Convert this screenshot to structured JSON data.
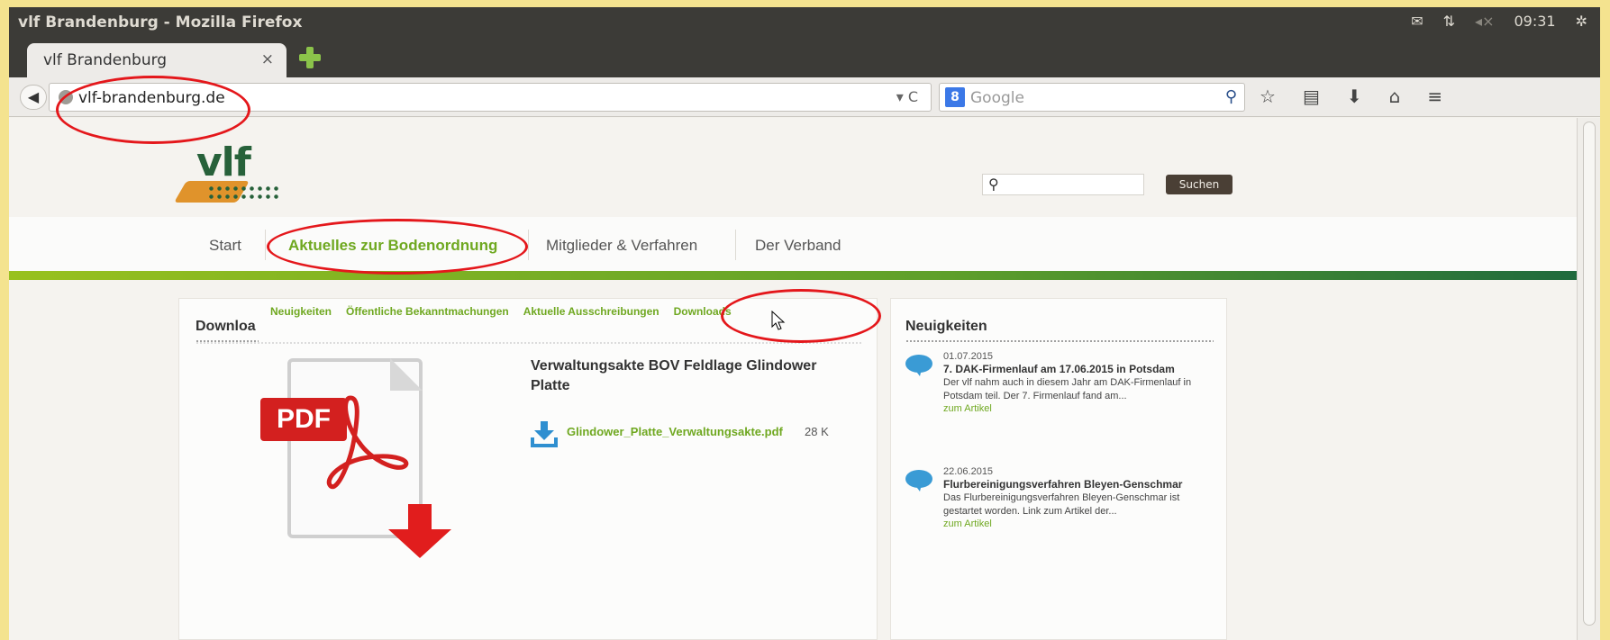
{
  "window": {
    "title": "vlf Brandenburg - Mozilla Firefox"
  },
  "tray": {
    "clock": "09:31"
  },
  "tab": {
    "label": "vlf Brandenburg",
    "close": "×"
  },
  "navbar": {
    "url": "vlf-brandenburg.de",
    "search_engine": "Google",
    "reload": "▾ C"
  },
  "site": {
    "logo_text": "vlf",
    "search_button": "Suchen",
    "main_nav": [
      "Start",
      "Aktuelles zur Bodenordnung",
      "Mitglieder & Verfahren",
      "Der Verband"
    ],
    "active_nav": "Aktuelles zur Bodenordnung",
    "sub_nav": [
      "Neuigkeiten",
      "Öffentliche Bekanntmachungen",
      "Aktuelle Ausschreibungen",
      "Downloads"
    ]
  },
  "downloads": {
    "heading": "Downloa",
    "pdf_badge": "PDF",
    "doc_title": "Verwaltungsakte BOV Feldlage Glindower Platte",
    "file_name": "Glindower_Platte_Verwaltungsakte.pdf",
    "file_size": "28 K"
  },
  "news": {
    "heading": "Neuigkeiten",
    "items": [
      {
        "date": "01.07.2015",
        "title": "7. DAK-Firmenlauf am 17.06.2015 in Potsdam",
        "text": "Der vlf nahm auch in diesem Jahr am DAK-Firmenlauf in Potsdam teil. Der 7. Firmenlauf fand am...",
        "link": "zum Artikel"
      },
      {
        "date": "22.06.2015",
        "title": "Flurbereinigungsverfahren Bleyen-Genschmar",
        "text": "Das Flurbereinigungsverfahren Bleyen-Genschmar ist gestartet worden. Link zum Artikel der...",
        "link": "zum Artikel"
      }
    ]
  },
  "colors": {
    "accent_green": "#6fa820",
    "annotation_red": "#e4171b",
    "titlebar": "#3c3b37"
  }
}
